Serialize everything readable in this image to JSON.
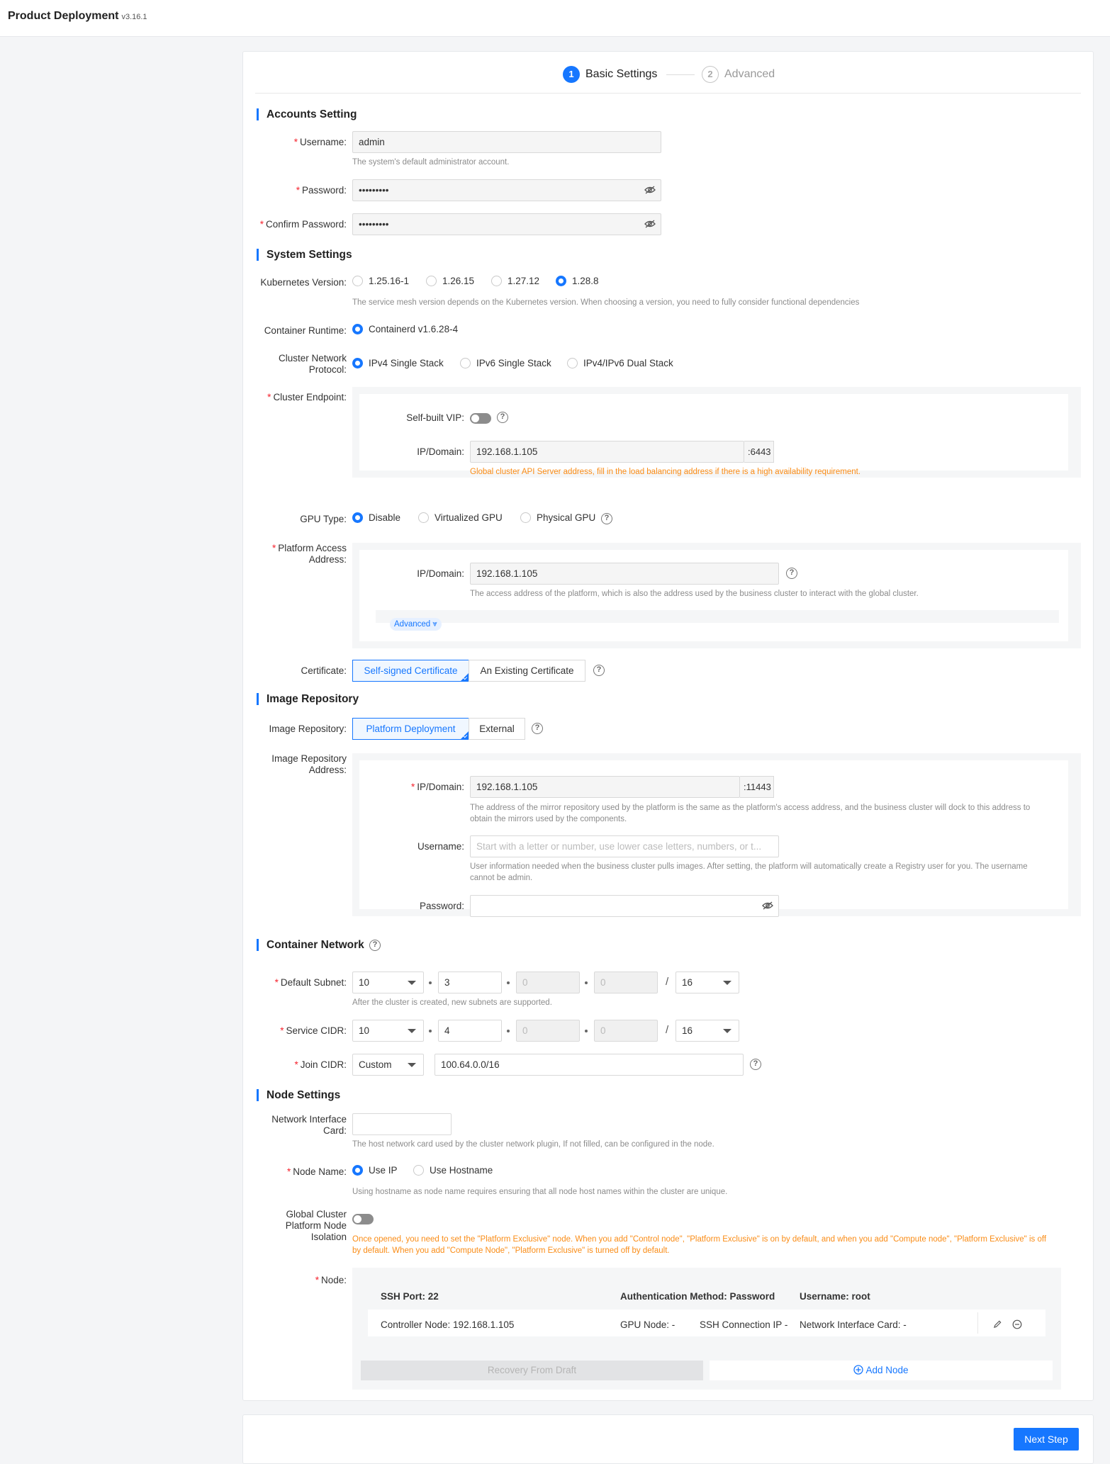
{
  "app": {
    "title": "Product Deployment",
    "version": "v3.16.1"
  },
  "steps": [
    {
      "num": "1",
      "label": "Basic Settings"
    },
    {
      "num": "2",
      "label": "Advanced"
    }
  ],
  "accounts": {
    "title": "Accounts Setting",
    "username_label": "Username:",
    "username_value": "admin",
    "username_help": "The system's default administrator account.",
    "password_label": "Password:",
    "password_value": "•••••••••",
    "confirm_label": "Confirm Password:",
    "confirm_value": "•••••••••"
  },
  "system": {
    "title": "System Settings",
    "k8s_label": "Kubernetes Version:",
    "k8s_options": [
      "1.25.16-1",
      "1.26.15",
      "1.27.12",
      "1.28.8"
    ],
    "k8s_help": "The service mesh version depends on the Kubernetes version. When choosing a version, you need to fully consider functional dependencies",
    "runtime_label": "Container Runtime:",
    "runtime_value": "Containerd v1.6.28-4",
    "protocol_label_1": "Cluster Network",
    "protocol_label_2": "Protocol:",
    "protocol_options": [
      "IPv4 Single Stack",
      "IPv6 Single Stack",
      "IPv4/IPv6 Dual Stack"
    ],
    "endpoint_label": "Cluster Endpoint:",
    "vip_label": "Self-built VIP:",
    "endpoint_ip_label": "IP/Domain:",
    "endpoint_ip_value": "192.168.1.105",
    "endpoint_port": ":6443",
    "endpoint_warn": "Global cluster API Server address, fill in the load balancing address if there is a high availability requirement.",
    "gpu_label": "GPU Type:",
    "gpu_options": [
      "Disable",
      "Virtualized GPU",
      "Physical GPU"
    ],
    "access_label_1": "Platform Access",
    "access_label_2": "Address:",
    "access_ip_label": "IP/Domain:",
    "access_ip_value": "192.168.1.105",
    "access_help": "The access address of the platform, which is also the address used by the business cluster to interact with the global cluster.",
    "advanced_btn": "Advanced",
    "cert_label": "Certificate:",
    "cert_options": [
      "Self-signed Certificate",
      "An Existing Certificate"
    ]
  },
  "image": {
    "title": "Image Repository",
    "repo_label": "Image Repository:",
    "repo_options": [
      "Platform Deployment",
      "External"
    ],
    "addr_label_1": "Image Repository",
    "addr_label_2": "Address:",
    "ip_label": "IP/Domain:",
    "ip_value": "192.168.1.105",
    "ip_port": ":11443",
    "ip_help_1": "The address of the mirror repository used by the platform is the same as the platform's access address, and the business cluster will dock to this address to",
    "ip_help_2": "obtain the mirrors used by the components.",
    "user_label": "Username:",
    "user_placeholder": "Start with a letter or number, use lower case letters, numbers, or t...",
    "user_help_1": "User information needed when the business cluster pulls images. After setting, the platform will automatically create a Registry user for you. The username",
    "user_help_2": "cannot be admin.",
    "pass_label": "Password:"
  },
  "network": {
    "title": "Container Network",
    "subnet_label": "Default Subnet:",
    "subnet": [
      "10",
      "3",
      "0",
      "0",
      "16"
    ],
    "subnet_help": "After the cluster is created, new subnets are supported.",
    "service_label": "Service CIDR:",
    "service": [
      "10",
      "4",
      "0",
      "0",
      "16"
    ],
    "join_label": "Join CIDR:",
    "join_mode": "Custom",
    "join_value": "100.64.0.0/16",
    "slash": "/"
  },
  "nodes": {
    "title": "Node Settings",
    "nic_label_1": "Network Interface",
    "nic_label_2": "Card:",
    "nic_help": "The host network card used by the cluster network plugin, If not filled, can be configured in the node.",
    "name_label": "Node Name:",
    "name_options": [
      "Use IP",
      "Use Hostname"
    ],
    "name_help": "Using hostname as node name requires ensuring that all node host names within the cluster are unique.",
    "iso_label_1": "Global Cluster",
    "iso_label_2": "Platform Node",
    "iso_label_3": "Isolation",
    "iso_warn_1": "Once opened, you need to set the \"Platform Exclusive\" node. When you add \"Control node\", \"Platform Exclusive\" is on by default, and when you add \"Compute node\", \"Platform Exclusive\" is off",
    "iso_warn_2": "by default. When you add \"Compute Node\", \"Platform Exclusive\" is turned off by default.",
    "node_label": "Node:",
    "ssh_port": "SSH Port:  22",
    "auth": "Authentication Method:  Password",
    "user": "Username:  root",
    "controller": "Controller Node:  192.168.1.105",
    "gpu": "GPU Node:  -",
    "ssh_ip": "SSH Connection IP -",
    "nic": "Network Interface Card:  -",
    "recovery": "Recovery From Draft",
    "add_node": "Add Node"
  },
  "footer": {
    "next": "Next Step"
  },
  "colors": {
    "accent": "#1677ff",
    "warning": "#fa8c16",
    "required": "#f5222d"
  }
}
